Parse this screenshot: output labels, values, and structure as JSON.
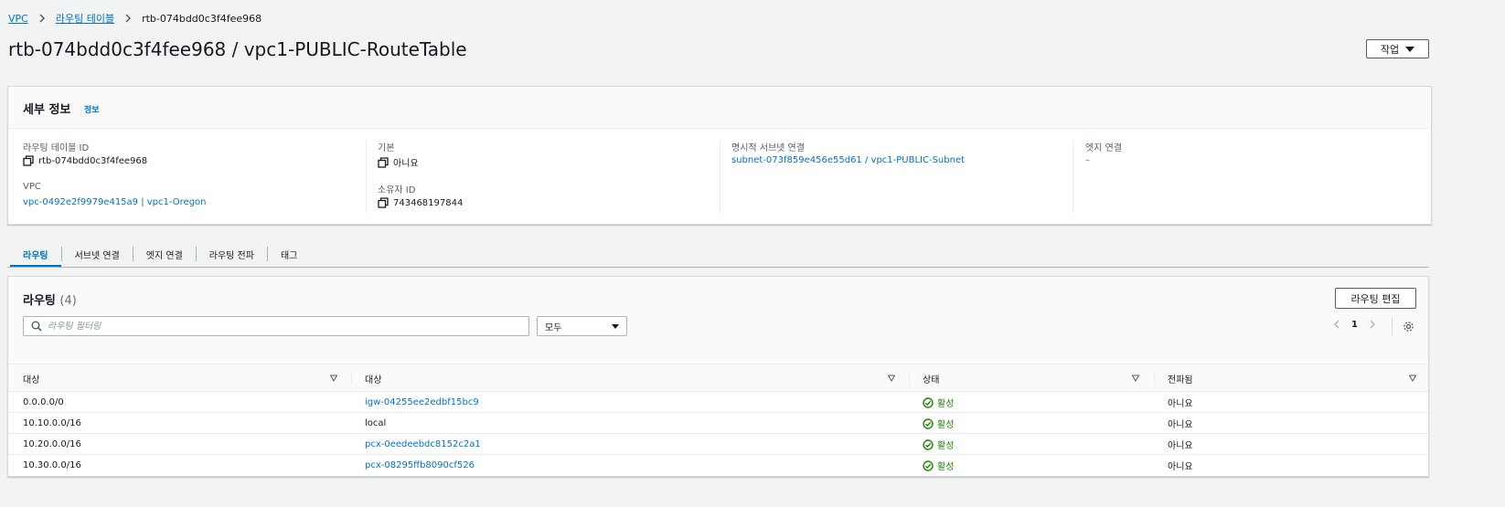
{
  "breadcrumb": {
    "items": [
      "VPC",
      "라우팅 테이블"
    ],
    "current": "rtb-074bdd0c3f4fee968"
  },
  "page": {
    "title": "rtb-074bdd0c3f4fee968 / vpc1-PUBLIC-RouteTable",
    "actions_label": "작업"
  },
  "details": {
    "title": "세부 정보",
    "info_link": "정보",
    "route_table_id_label": "라우팅 테이블 ID",
    "route_table_id": "rtb-074bdd0c3f4fee968",
    "vpc_label": "VPC",
    "vpc": "vpc-0492e2f9979e415a9 | vpc1-Oregon",
    "main_label": "기본",
    "main": "아니요",
    "owner_label": "소유자 ID",
    "owner": "743468197844",
    "subnet_assoc_label": "명시적 서브넷 연결",
    "subnet_assoc": "subnet-073f859e456e55d61 / vpc1-PUBLIC-Subnet",
    "edge_assoc_label": "엣지 연결",
    "edge_assoc": "–"
  },
  "tabs": [
    "라우팅",
    "서브넷 연결",
    "엣지 연결",
    "라우팅 전파",
    "태그"
  ],
  "routes": {
    "title": "라우팅",
    "count": "(4)",
    "edit_label": "라우팅 편집",
    "search_placeholder": "라우팅 필터링",
    "filter_value": "모두",
    "page": "1",
    "columns": [
      "대상",
      "대상",
      "상태",
      "전파됨"
    ],
    "rows": [
      {
        "destination": "0.0.0.0/0",
        "target": "igw-04255ee2edbf15bc9",
        "target_link": true,
        "status": "활성",
        "propagated": "아니요"
      },
      {
        "destination": "10.10.0.0/16",
        "target": "local",
        "target_link": false,
        "status": "활성",
        "propagated": "아니요"
      },
      {
        "destination": "10.20.0.0/16",
        "target": "pcx-0eedeebdc8152c2a1",
        "target_link": true,
        "status": "활성",
        "propagated": "아니요"
      },
      {
        "destination": "10.30.0.0/16",
        "target": "pcx-08295ffb8090cf526",
        "target_link": true,
        "status": "활성",
        "propagated": "아니요"
      }
    ]
  },
  "colors": {
    "link": "#0073bb",
    "success": "#1d8102",
    "background": "#f2f3f3"
  }
}
